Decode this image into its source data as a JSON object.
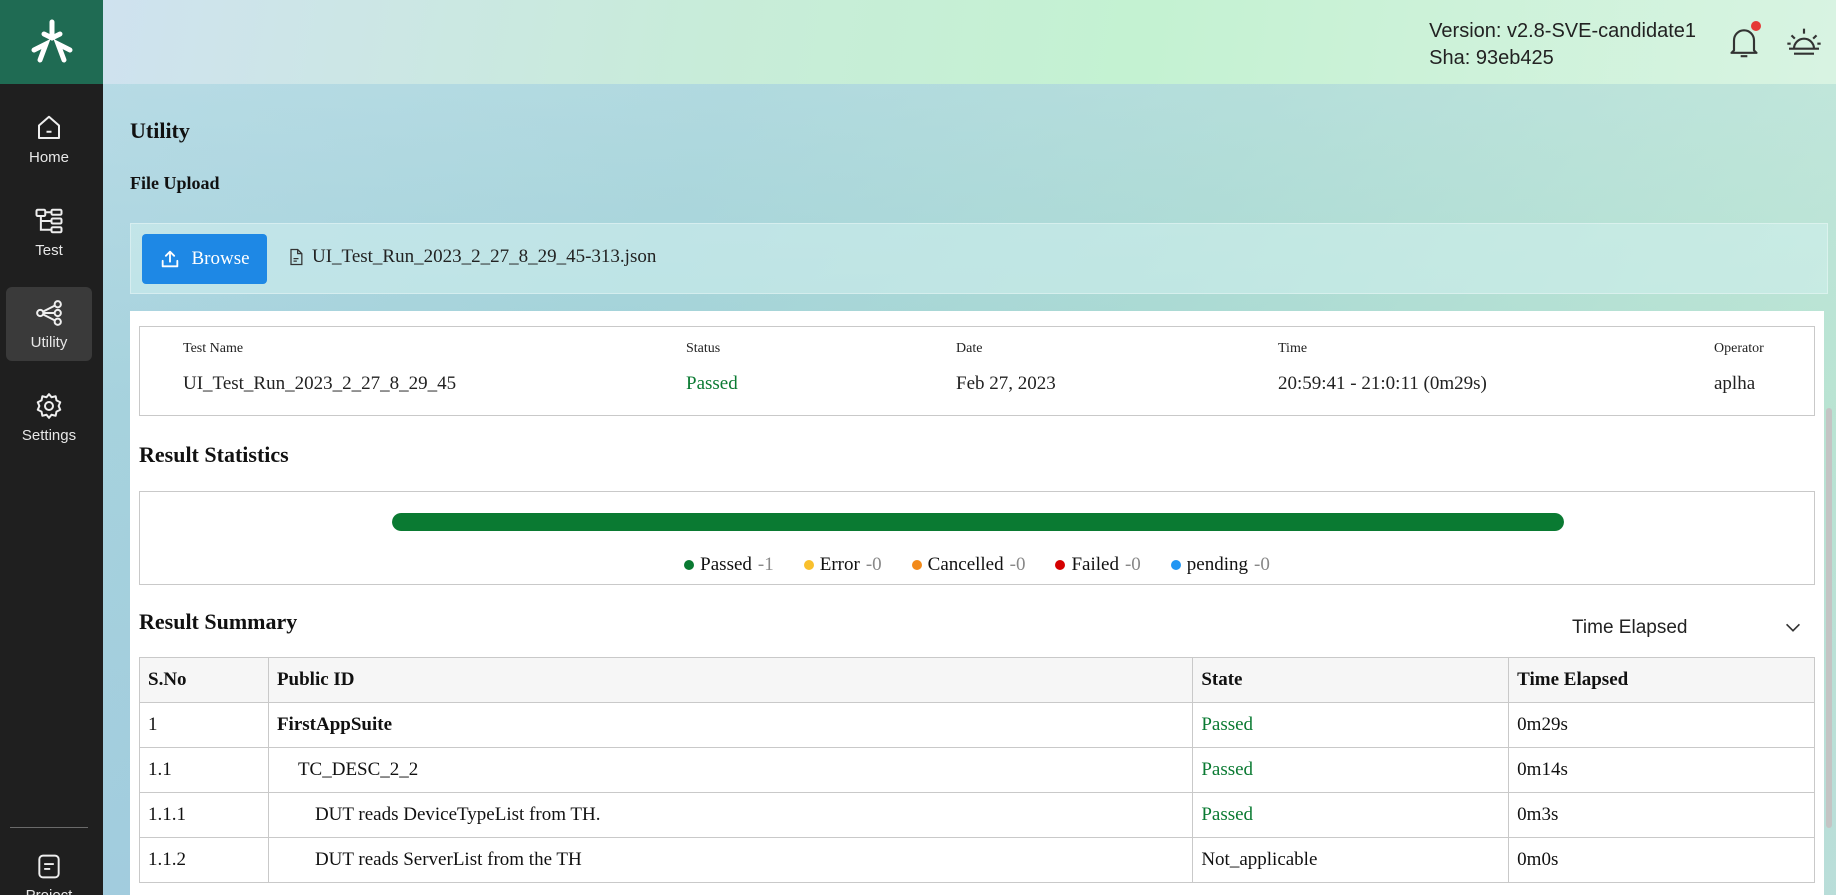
{
  "sidebar": {
    "items": [
      {
        "label": "Home",
        "icon": "home-icon"
      },
      {
        "label": "Test",
        "icon": "tree-icon"
      },
      {
        "label": "Utility",
        "icon": "share-icon"
      },
      {
        "label": "Settings",
        "icon": "gear-icon"
      },
      {
        "label": "Project",
        "icon": "project-icon"
      }
    ],
    "active": "Utility"
  },
  "header": {
    "version": "Version: v2.8-SVE-candidate1",
    "sha": "Sha: 93eb425"
  },
  "page": {
    "title": "Utility",
    "section": "File Upload"
  },
  "upload": {
    "browse_label": "Browse",
    "file_name": "UI_Test_Run_2023_2_27_8_29_45-313.json"
  },
  "run_info": {
    "test_name_label": "Test Name",
    "test_name": "UI_Test_Run_2023_2_27_8_29_45",
    "status_label": "Status",
    "status": "Passed",
    "date_label": "Date",
    "date": "Feb 27, 2023",
    "time_label": "Time",
    "time": "20:59:41 - 21:0:11 (0m29s)",
    "operator_label": "Operator",
    "operator": "aplha"
  },
  "statistics": {
    "title": "Result Statistics",
    "progress_passed_fraction": 1.0,
    "legend": [
      {
        "label": "Passed",
        "count": "-1",
        "color": "#0a7a32"
      },
      {
        "label": "Error",
        "count": "-0",
        "color": "#f9c02d"
      },
      {
        "label": "Cancelled",
        "count": "-0",
        "color": "#f28a1a"
      },
      {
        "label": "Failed",
        "count": "-0",
        "color": "#d50000"
      },
      {
        "label": "pending",
        "count": "-0",
        "color": "#2196f3"
      }
    ]
  },
  "summary": {
    "title": "Result Summary",
    "sort_select": "Time Elapsed",
    "columns": [
      "S.No",
      "Public ID",
      "State",
      "Time Elapsed"
    ],
    "rows": [
      {
        "sno": "1",
        "id": "FirstAppSuite",
        "state": "Passed",
        "time": "0m29s"
      },
      {
        "sno": "1.1",
        "id": "TC_DESC_2_2",
        "state": "Passed",
        "time": "0m14s"
      },
      {
        "sno": "1.1.1",
        "id": "DUT reads DeviceTypeList from TH.",
        "state": "Passed",
        "time": "0m3s"
      },
      {
        "sno": "1.1.2",
        "id": "DUT reads ServerList from the TH",
        "state": "Not_applicable",
        "time": "0m0s"
      }
    ]
  },
  "colors": {
    "sidebar_bg": "#1f1f1f",
    "logo_bg": "#1f6b53",
    "accent": "#1e88e5",
    "passed": "#0a7a32"
  }
}
